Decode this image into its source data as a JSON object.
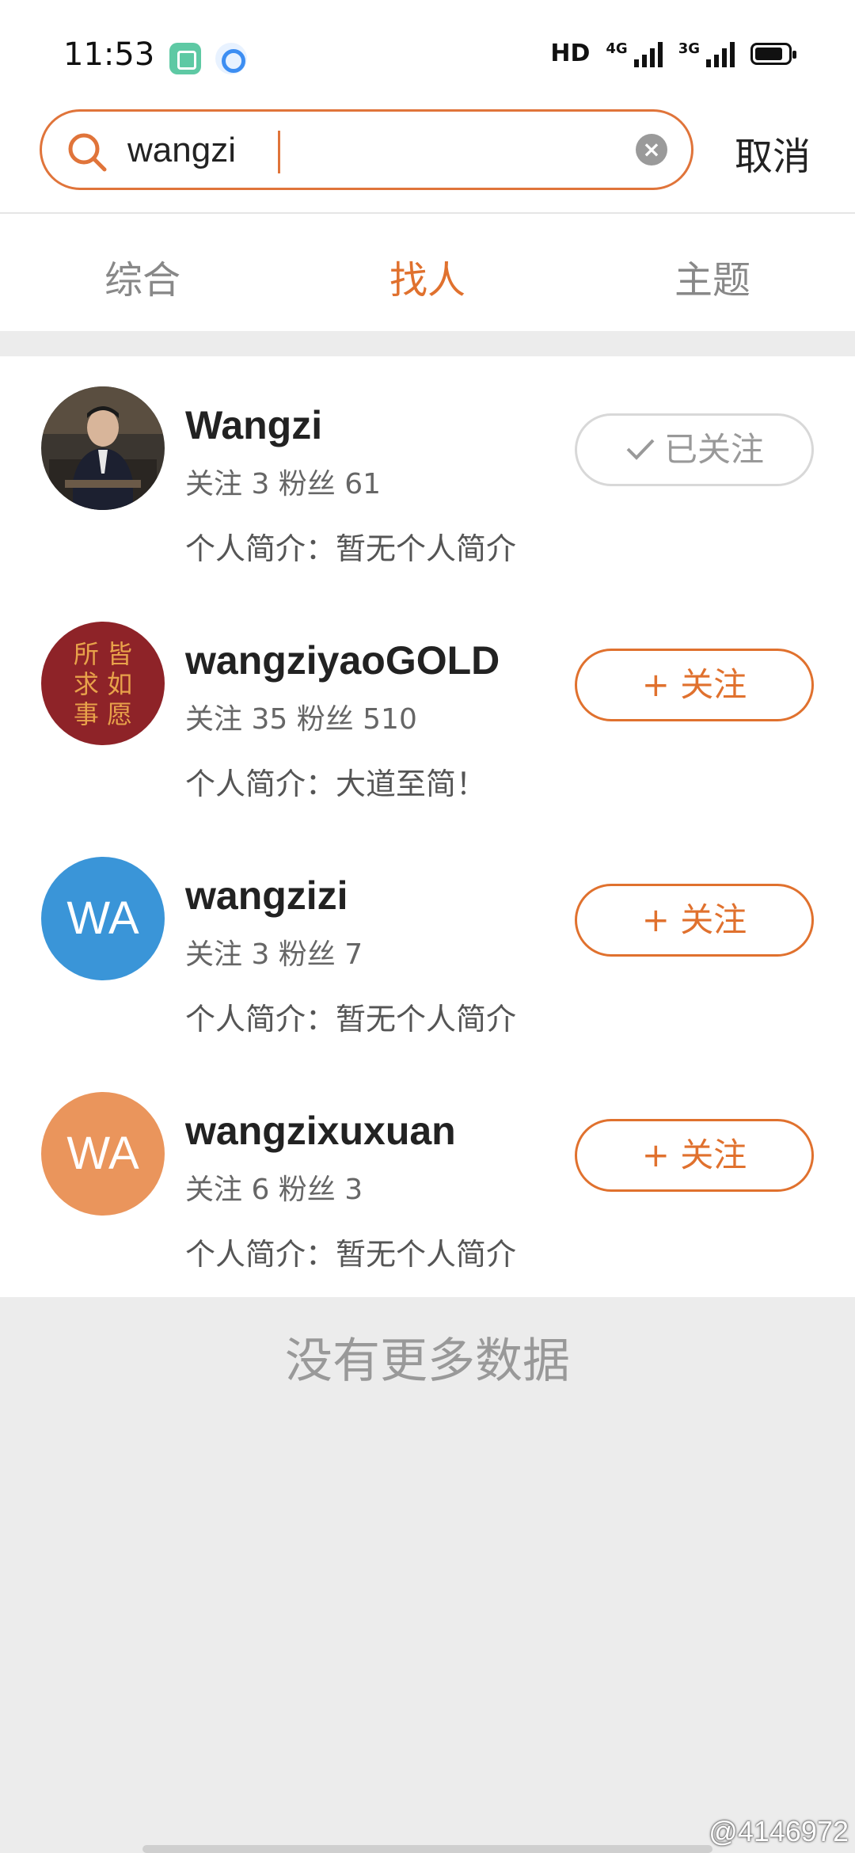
{
  "status_bar": {
    "time": "11:53",
    "hd_label": "HD",
    "net1_label": "4G",
    "net2_label": "3G"
  },
  "search": {
    "value": "wangzi",
    "placeholder": "",
    "cancel_label": "取消"
  },
  "tabs": [
    {
      "label": "综合",
      "active": false
    },
    {
      "label": "找人",
      "active": true
    },
    {
      "label": "主题",
      "active": false
    }
  ],
  "users": [
    {
      "name": "Wangzi",
      "stats": "关注 3 粉丝 61",
      "bio": "个人简介：暂无个人简介",
      "button_label": "已关注",
      "followed": true,
      "avatar_type": "photo"
    },
    {
      "name": "wangziyaoGOLD",
      "stats": "关注 35 粉丝 510",
      "bio": "个人简介：大道至简！",
      "button_label": "+ 关注",
      "followed": false,
      "avatar_type": "calligraphy",
      "avatar_text_lines": [
        "所 皆",
        "求 如",
        "事 愿"
      ]
    },
    {
      "name": "wangzizi",
      "stats": "关注 3 粉丝 7",
      "bio": "个人简介：暂无个人简介",
      "button_label": "+ 关注",
      "followed": false,
      "avatar_type": "initials",
      "avatar_initials": "WA",
      "avatar_color": "#3a95d8"
    },
    {
      "name": "wangzixuxuan",
      "stats": "关注 6 粉丝 3",
      "bio": "个人简介：暂无个人简介",
      "button_label": "+ 关注",
      "followed": false,
      "avatar_type": "initials",
      "avatar_initials": "WA",
      "avatar_color": "#ea955c"
    }
  ],
  "footer": {
    "no_more_label": "没有更多数据"
  },
  "watermark": "@4146972",
  "colors": {
    "accent": "#e0712e",
    "search_border": "#e0743a"
  }
}
